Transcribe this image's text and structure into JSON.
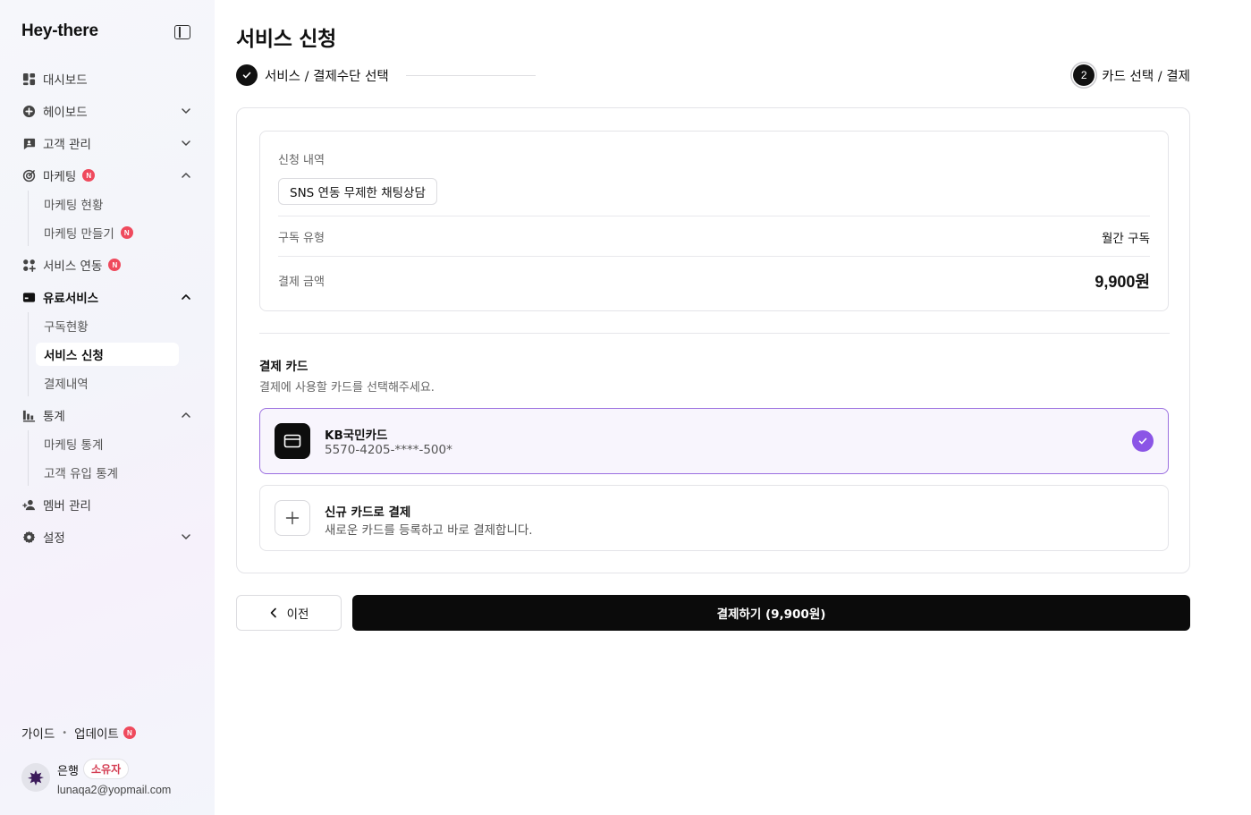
{
  "sidebar": {
    "brand": "Hey-there",
    "items": [
      {
        "label": "대시보드",
        "icon": "dashboard-icon"
      },
      {
        "label": "헤이보드",
        "icon": "plus-circle-icon"
      },
      {
        "label": "고객 관리",
        "icon": "chat-bubble-icon"
      },
      {
        "label": "마케팅",
        "icon": "target-icon",
        "badge": "N"
      },
      {
        "label": "서비스 연동",
        "icon": "apps-grid-icon",
        "badge": "N"
      },
      {
        "label": "유료서비스",
        "icon": "credit-card-icon"
      },
      {
        "label": "통계",
        "icon": "bar-chart-icon"
      },
      {
        "label": "멤버 관리",
        "icon": "members-icon"
      },
      {
        "label": "설정",
        "icon": "gear-icon"
      }
    ],
    "marketing_sub": [
      {
        "label": "마케팅 현황"
      },
      {
        "label": "마케팅 만들기",
        "badge": "N"
      }
    ],
    "paid_sub": [
      {
        "label": "구독현황"
      },
      {
        "label": "서비스 신청"
      },
      {
        "label": "결제내역"
      }
    ],
    "stats_sub": [
      {
        "label": "마케팅 통계"
      },
      {
        "label": "고객 유입 통계"
      }
    ],
    "footer": {
      "guide": "가이드",
      "separator": "•",
      "update": "업데이트",
      "update_badge": "N"
    },
    "user": {
      "name": "은행",
      "role": "소유자",
      "email": "lunaqa2@yopmail.com"
    }
  },
  "main": {
    "title": "서비스 신청",
    "steps": [
      {
        "label": "서비스 / 결제수단 선택",
        "status": "done"
      },
      {
        "number": "2",
        "label": "카드 선택 / 결제",
        "status": "current"
      }
    ],
    "summary": {
      "applied_label": "신청 내역",
      "service": "SNS 연동 무제한 채팅상담",
      "subscription_label": "구독 유형",
      "subscription_value": "월간 구독",
      "amount_label": "결제 금액",
      "amount_value": "9,900원"
    },
    "payment": {
      "title": "결제 카드",
      "description": "결제에 사용할 카드를 선택해주세요.",
      "cards": [
        {
          "name": "KB국민카드",
          "number": "5570-4205-****-500*",
          "selected": true
        },
        {
          "name": "신규 카드로 결제",
          "number": "새로운 카드를 등록하고 바로 결제합니다.",
          "selected": false
        }
      ]
    },
    "buttons": {
      "prev": "이전",
      "pay": "결제하기 (9,900원)"
    }
  },
  "colors": {
    "accent_purple": "#8b55e6",
    "badge_red": "#ef4a5d",
    "primary_black": "#0b0b0b"
  }
}
